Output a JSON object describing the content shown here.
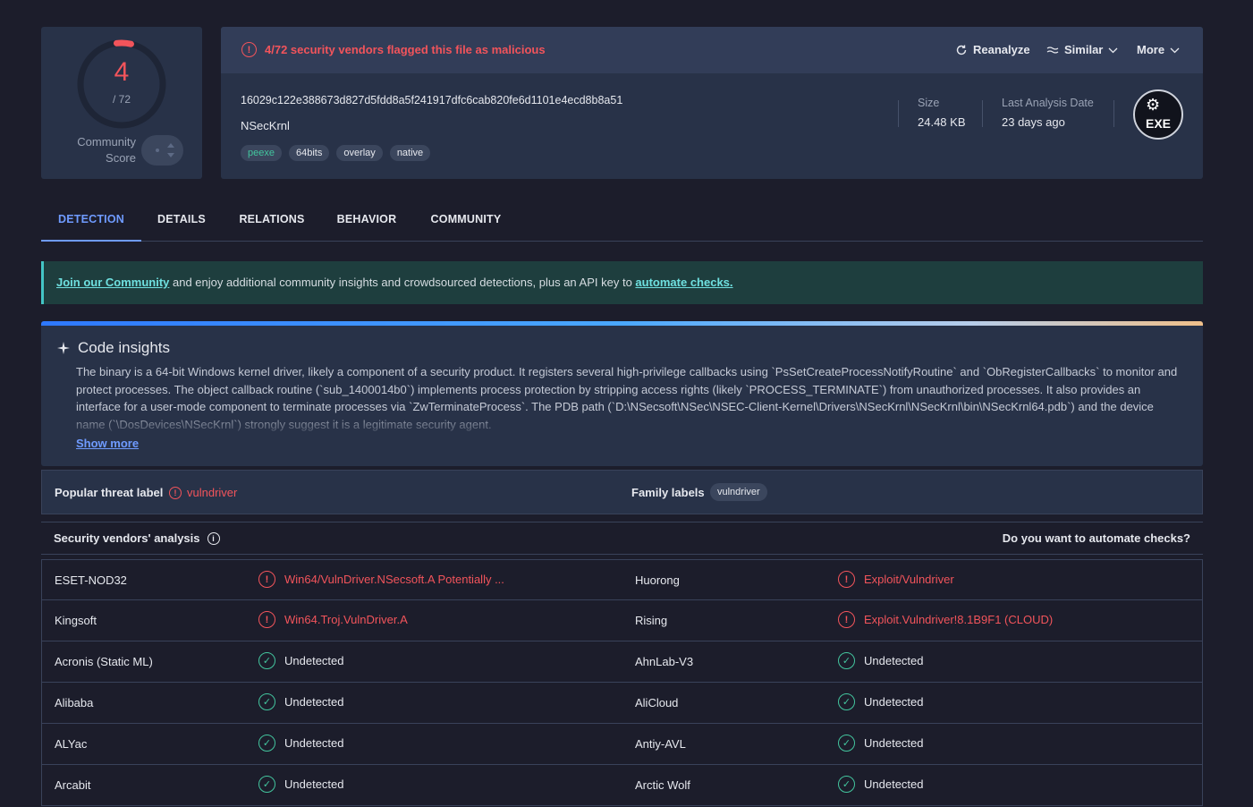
{
  "score": {
    "detections": "4",
    "total": "/ 72",
    "community_label": "Community\nScore",
    "ratio": 0.0556
  },
  "file": {
    "alert": "4/72 security vendors flagged this file as malicious",
    "reanalyze": "Reanalyze",
    "similar": "Similar",
    "more": "More",
    "hash": "16029c122e388673d827d5fdd8a5f241917dfc6cab820fe6d1101e4ecd8b8a51",
    "name": "NSecKrnl",
    "tags": [
      "peexe",
      "64bits",
      "overlay",
      "native"
    ],
    "size_label": "Size",
    "size_value": "24.48 KB",
    "date_label": "Last Analysis Date",
    "date_value": "23 days ago",
    "type_badge": "EXE"
  },
  "tabs": [
    "DETECTION",
    "DETAILS",
    "RELATIONS",
    "BEHAVIOR",
    "COMMUNITY"
  ],
  "banner": {
    "link1": "Join our Community",
    "text": " and enjoy additional community insights and crowdsourced detections, plus an API key to ",
    "link2": "automate checks."
  },
  "insights": {
    "title": "Code insights",
    "text": "The binary is a 64-bit Windows kernel driver, likely a component of a security product. It registers several high-privilege callbacks using `PsSetCreateProcessNotifyRoutine` and `ObRegisterCallbacks` to monitor and protect processes. The object callback routine (`sub_1400014b0`) implements process protection by stripping access rights (likely `PROCESS_TERMINATE`) from unauthorized processes. It also provides an interface for a user-mode component to terminate processes via `ZwTerminateProcess`. The PDB path (`D:\\NSecsoft\\NSec\\NSEC-Client-Kernel\\Drivers\\NSecKrnl\\NSecKrnl\\bin\\NSecKrnl64.pdb`) and the device name (`\\DosDevices\\NSecKrnl`) strongly suggest it is a legitimate security agent.",
    "show_more": "Show more"
  },
  "threat": {
    "popular_label": "Popular threat label",
    "popular_value": "vulndriver",
    "family_label": "Family labels",
    "family_value": "vulndriver"
  },
  "vendors": {
    "title": "Security vendors' analysis",
    "automate": "Do you want to automate checks?",
    "rows": [
      {
        "v1": "ESET-NOD32",
        "r1": "Win64/VulnDriver.NSecsoft.A Potentially ...",
        "s1": "bad",
        "v2": "Huorong",
        "r2": "Exploit/Vulndriver",
        "s2": "bad"
      },
      {
        "v1": "Kingsoft",
        "r1": "Win64.Troj.VulnDriver.A",
        "s1": "bad",
        "v2": "Rising",
        "r2": "Exploit.Vulndriver!8.1B9F1 (CLOUD)",
        "s2": "bad"
      },
      {
        "v1": "Acronis (Static ML)",
        "r1": "Undetected",
        "s1": "ok",
        "v2": "AhnLab-V3",
        "r2": "Undetected",
        "s2": "ok"
      },
      {
        "v1": "Alibaba",
        "r1": "Undetected",
        "s1": "ok",
        "v2": "AliCloud",
        "r2": "Undetected",
        "s2": "ok"
      },
      {
        "v1": "ALYac",
        "r1": "Undetected",
        "s1": "ok",
        "v2": "Antiy-AVL",
        "r2": "Undetected",
        "s2": "ok"
      },
      {
        "v1": "Arcabit",
        "r1": "Undetected",
        "s1": "ok",
        "v2": "Arctic Wolf",
        "r2": "Undetected",
        "s2": "ok"
      }
    ]
  },
  "colors": {
    "accent": "#6f9bff",
    "malicious": "#f2545b",
    "clean": "#43c59e"
  }
}
